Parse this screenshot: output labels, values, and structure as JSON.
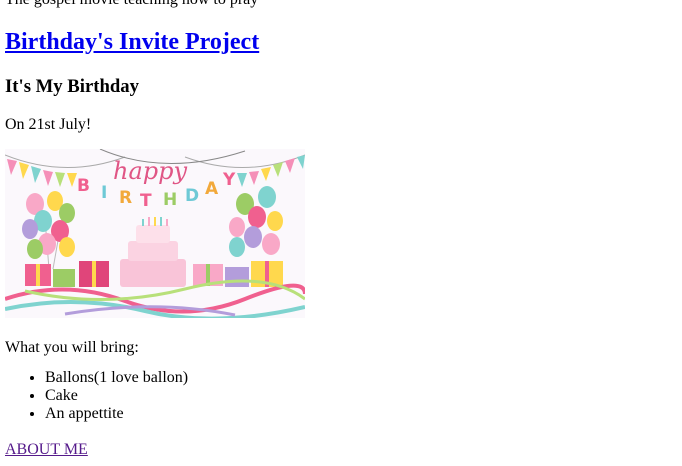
{
  "top_text": "The gospel movie teaching how to pray",
  "project_title": "Birthday's Invite Project",
  "heading": "It's My Birthday",
  "date_line": "On 21st July!",
  "banner": {
    "text_happy": "happy",
    "letters": [
      "B",
      "I",
      "R",
      "T",
      "H",
      "D",
      "A",
      "Y"
    ]
  },
  "bring_label": "What you will bring:",
  "items": [
    "Ballons(1 love ballon)",
    "Cake",
    "An appettite"
  ],
  "about_link": "ABOUT ME",
  "colors": {
    "link": "#0000ee",
    "visited_link": "#551a8b"
  }
}
